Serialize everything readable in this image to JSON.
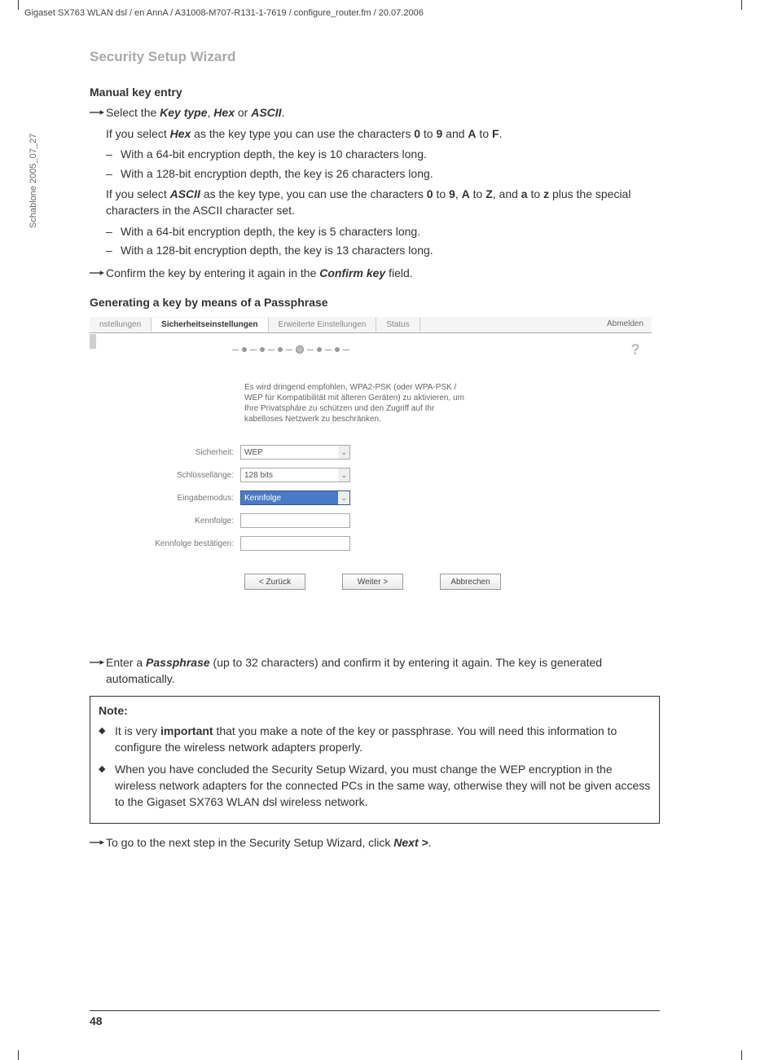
{
  "header_path": "Gigaset SX763 WLAN dsl / en AnnA / A31008-M707-R131-1-7619 / configure_router.fm / 20.07.2006",
  "side_text": "Schablone 2005_07_27",
  "section_title": "Security Setup Wizard",
  "manual_heading": "Manual key entry",
  "line1_pre": "Select the ",
  "line1_keytype": "Key type",
  "line1_mid": ", ",
  "line1_hex": "Hex",
  "line1_or": " or ",
  "line1_ascii": "ASCII",
  "line1_end": ".",
  "hex_intro_pre": "If you select ",
  "hex_intro_hex": "Hex",
  "hex_intro_mid": " as the key type you can use the characters ",
  "hex_0": "0",
  "hex_to1": " to ",
  "hex_9": "9",
  "hex_and": " and ",
  "hex_A": "A",
  "hex_to2": " to ",
  "hex_F": "F",
  "hex_end": ".",
  "hex_b1": "With a 64-bit encryption depth, the key is 10 characters long.",
  "hex_b2": "With a 128-bit encryption depth, the key is 26 characters long.",
  "ascii_intro_pre": "If you select ",
  "ascii_intro_ascii": "ASCII",
  "ascii_intro_mid": " as the key type, you can use the characters ",
  "ascii_0": "0",
  "ascii_to1": " to ",
  "ascii_9": "9",
  "ascii_comma": ", ",
  "ascii_A": "A",
  "ascii_to2": " to ",
  "ascii_Z": "Z",
  "ascii_and": ", and ",
  "ascii_a": "a",
  "ascii_to3": " to ",
  "ascii_z": "z",
  "ascii_end": " plus the special characters in the ASCII character set.",
  "ascii_b1": "With a 64-bit encryption depth, the key is 5 characters long.",
  "ascii_b2": "With a 128-bit encryption depth, the key is 13 characters long.",
  "confirm_pre": "Confirm the key by entering it again in the ",
  "confirm_key": "Confirm key",
  "confirm_end": " field.",
  "passphrase_heading": "Generating a key by means of a Passphrase",
  "ui": {
    "tab1": "nstellungen",
    "tab2": "Sicherheitseinstellungen",
    "tab3": "Erweiterte Einstellungen",
    "tab4": "Status",
    "logout": "Abmelden",
    "desc": "Es wird dringend empfohlen, WPA2-PSK (oder WPA-PSK / WEP für Kompatibilität mit älteren Geräten) zu aktivieren, um Ihre Privatsphäre zu schützen und den Zugriff auf Ihr kabelloses Netzwerk zu beschränken.",
    "label_security": "Sicherheit:",
    "val_security": "WEP",
    "label_keylen": "Schlüssellänge:",
    "val_keylen": "128 bits",
    "label_inputmode": "Eingabemodus:",
    "val_inputmode": "Kennfolge",
    "label_pass": "Kennfolge:",
    "label_pass_confirm": "Kennfolge bestätigen:",
    "btn_back": "< Zurück",
    "btn_next": "Weiter >",
    "btn_cancel": "Abbrechen",
    "help": "?"
  },
  "enter_pass_pre": "Enter a ",
  "enter_pass_bold": "Passphrase",
  "enter_pass_end": " (up to 32 characters) and confirm it by entering it again. The key is generated automatically.",
  "note_title": "Note:",
  "note1_pre": "It is very ",
  "note1_bold": "important",
  "note1_end": " that you make a note of the key or passphrase. You will need this information to configure the wireless network adapters properly.",
  "note2": "When you have concluded the Security Setup Wizard, you must change the WEP encryption in the wireless network adapters for the connected PCs in the same way, otherwise they will not be given access to the Gigaset SX763 WLAN dsl wireless network.",
  "next_step_pre": "To go to the next step in the Security Setup Wizard, click ",
  "next_step_bold": "Next >",
  "next_step_end": ".",
  "page_number": "48"
}
